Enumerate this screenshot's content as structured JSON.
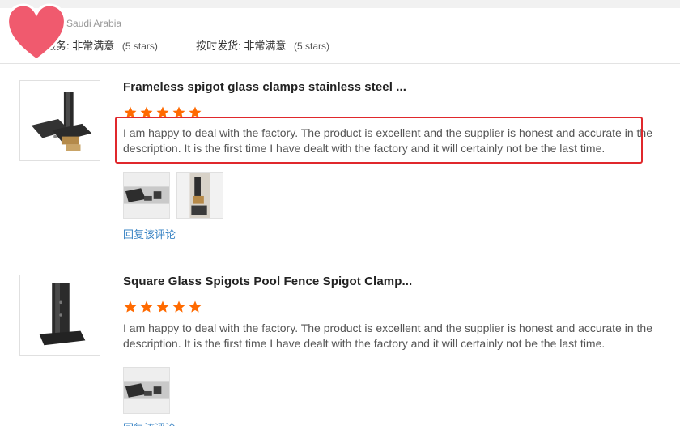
{
  "header": {
    "country": "Saudi Arabia",
    "service_label": "服务:",
    "service_value": "非常满意",
    "service_stars": "(5 stars)",
    "shipping_label": "按时发货:",
    "shipping_value": "非常满意",
    "shipping_stars": "(5 stars)"
  },
  "reviews": [
    {
      "title": "Frameless spigot glass clamps stainless steel ...",
      "rating": 5,
      "text": "I am happy to deal with the factory. The product is excellent and the supplier is honest and accurate in the description. It is the first time I have dealt with the factory and it will certainly not be the last time.",
      "reply_label": "回复该评论",
      "photo_count": 2
    },
    {
      "title": "Square Glass Spigots Pool Fence Spigot Clamp...",
      "rating": 5,
      "text": "I am happy to deal with the factory. The product is excellent and the supplier is honest and accurate in the description. It is the first time I have dealt with the factory and it will certainly not be the last time.",
      "reply_label": "回复该评论",
      "photo_count": 1
    }
  ],
  "colors": {
    "star": "#ff6a00",
    "link": "#3a84c4",
    "highlight": "#e0282c",
    "heart": "#f05a6e"
  }
}
